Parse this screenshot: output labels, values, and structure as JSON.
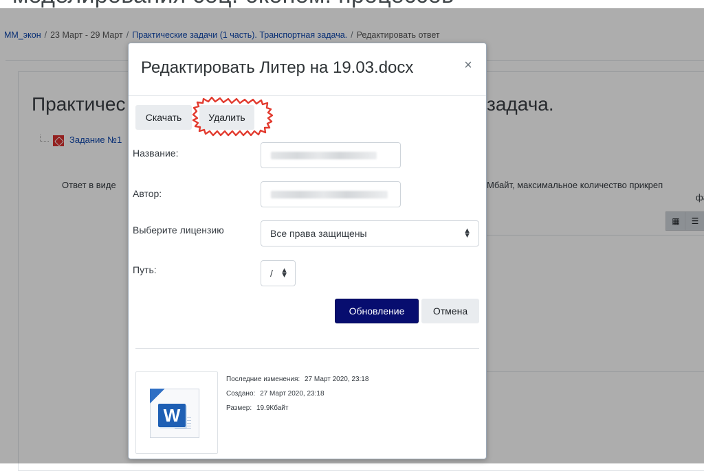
{
  "page": {
    "heading_top": "моделирования соц.-эконом. процессов",
    "breadcrumb": [
      {
        "label": "ММ_экон",
        "link": true
      },
      {
        "label": "23 Март - 29 Март",
        "link": false
      },
      {
        "label": "Практические задачи (1 часть). Транспортная задача.",
        "link": true
      },
      {
        "label": "Редактировать ответ",
        "link": false
      }
    ],
    "card_title_left": "Практичес",
    "card_title_right": "задача.",
    "file_link": "Задание №1",
    "submission_text_left": "Ответ в виде",
    "submission_text_right": "Мбайт, максимальное количество прикреп",
    "submission_text_right_2": "фай"
  },
  "modal": {
    "title": "Редактировать Литер на 19.03.docx",
    "close_label": "×",
    "download_label": "Скачать",
    "delete_label": "Удалить",
    "fields": {
      "name_label": "Название:",
      "author_label": "Автор:",
      "license_label": "Выберите лицензию",
      "license_value": "Все права защищены",
      "path_label": "Путь:",
      "path_value": "/"
    },
    "update_label": "Обновление",
    "cancel_label": "Отмена",
    "file_info": {
      "modified_label": "Последние изменения:",
      "modified_value": "27 Март 2020, 23:18",
      "created_label": "Создано:",
      "created_value": "27 Март 2020, 23:18",
      "size_label": "Размер:",
      "size_value": "19.9Кбайт"
    },
    "thumbnail_icon": "word-document-icon"
  },
  "colors": {
    "primary_button": "#070d6f",
    "link": "#0f47ad",
    "highlight_stroke": "#e23a2e"
  }
}
